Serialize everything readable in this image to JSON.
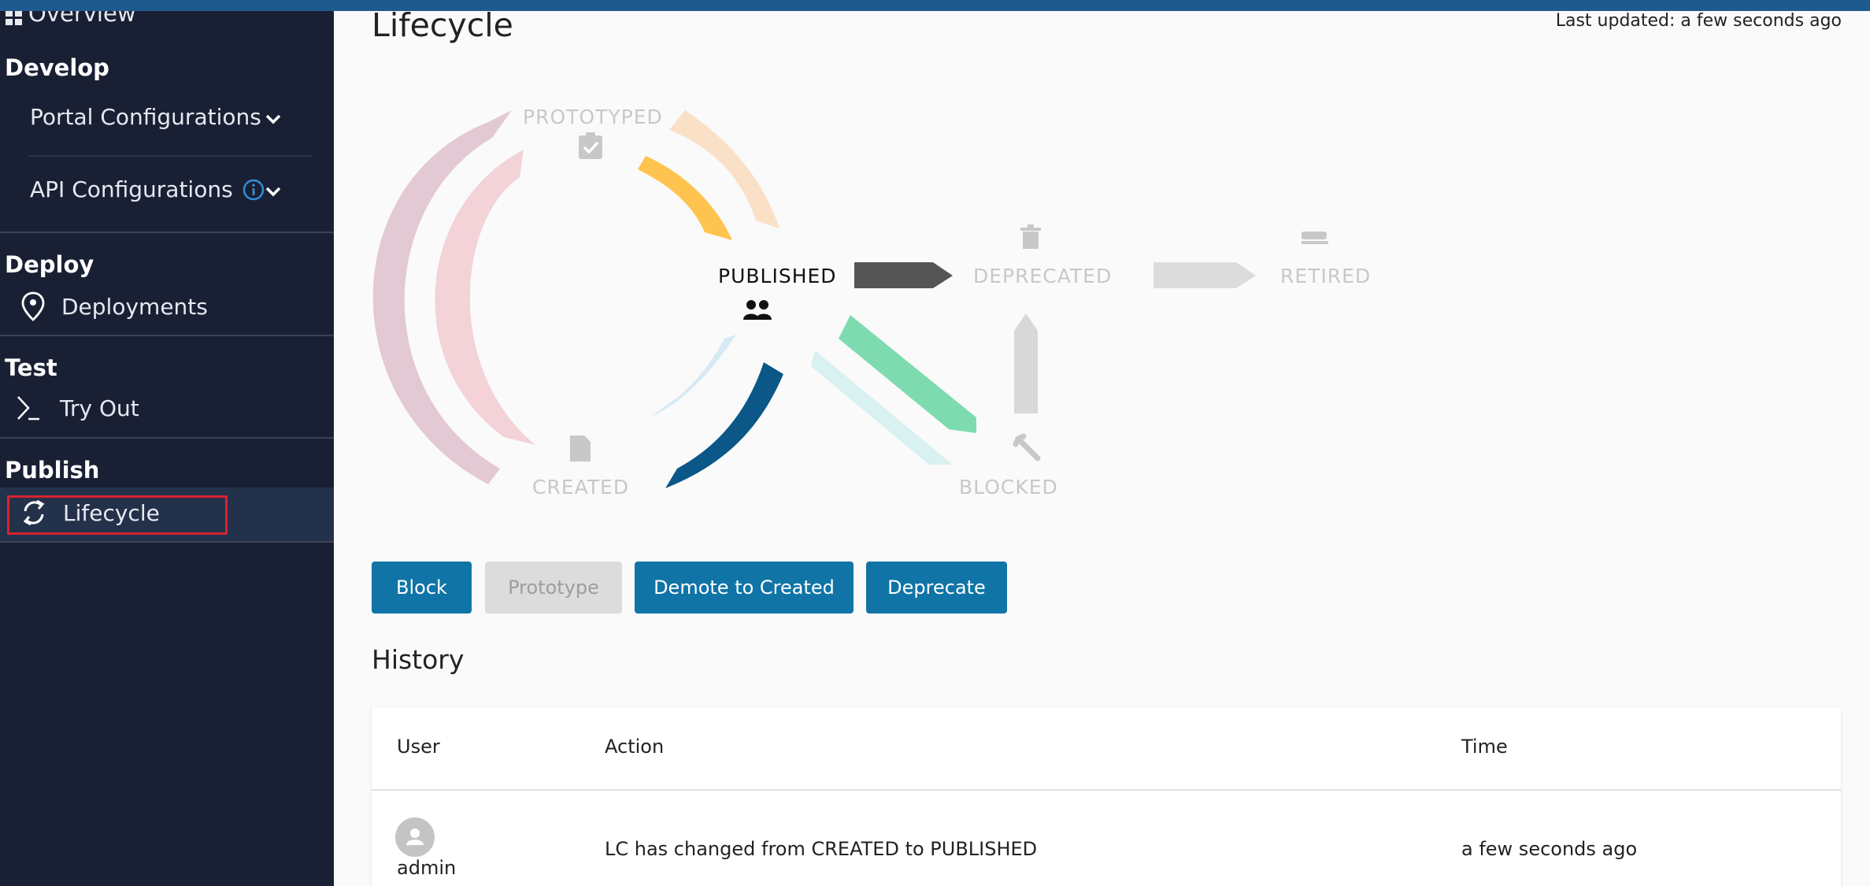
{
  "sidebar": {
    "overview_label": "Overview",
    "sections": {
      "develop": "Develop",
      "deploy": "Deploy",
      "test": "Test",
      "publish": "Publish"
    },
    "items": {
      "portal_configurations": "Portal Configurations",
      "api_configurations": "API Configurations",
      "deployments": "Deployments",
      "try_out": "Try Out",
      "lifecycle": "Lifecycle"
    }
  },
  "header": {
    "title": "Lifecycle",
    "last_updated": "Last updated: a few seconds ago"
  },
  "lifecycle": {
    "current_state": "PUBLISHED",
    "states": {
      "prototyped": "PROTOTYPED",
      "published": "PUBLISHED",
      "deprecated": "DEPRECATED",
      "retired": "RETIRED",
      "created": "CREATED",
      "blocked": "BLOCKED"
    }
  },
  "actions": {
    "block": "Block",
    "prototype": "Prototype",
    "demote": "Demote to Created",
    "deprecate": "Deprecate"
  },
  "history": {
    "title": "History",
    "columns": {
      "user": "User",
      "action": "Action",
      "time": "Time"
    },
    "rows": [
      {
        "user": "admin",
        "action": "LC has changed from CREATED to PUBLISHED",
        "time": "a few seconds ago"
      }
    ]
  },
  "colors": {
    "accent": "#1074a6",
    "sidebar_bg": "#1a2034",
    "highlight_border": "#d6232f"
  }
}
